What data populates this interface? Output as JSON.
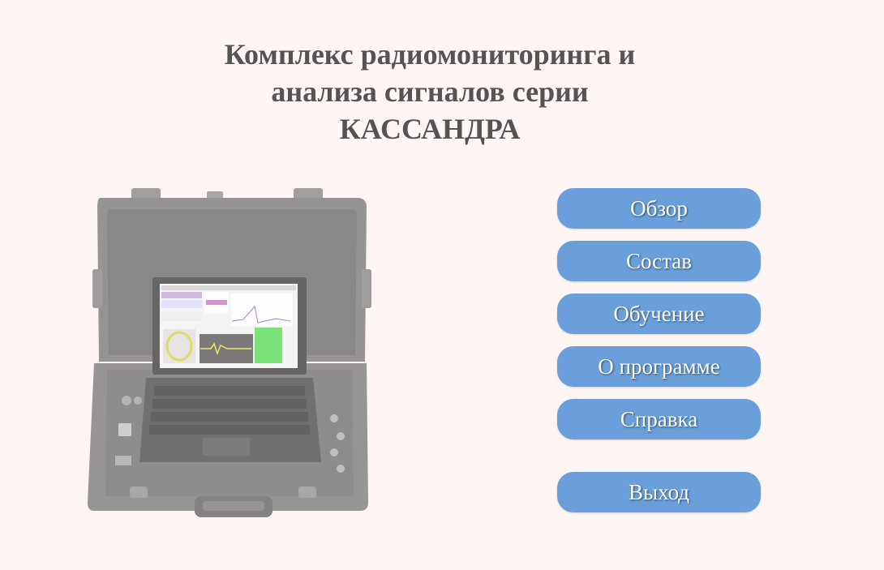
{
  "title": {
    "line1": "Комплекс радиомониторинга и",
    "line2": "анализа сигналов серии",
    "line3": "КАССАНДРА"
  },
  "menu": {
    "overview": "Обзор",
    "composition": "Состав",
    "training": "Обучение",
    "about": "О программе",
    "help": "Справка",
    "exit": "Выход"
  },
  "colors": {
    "background": "#fdf6f4",
    "button": "#6a9fdb",
    "title": "#555353"
  }
}
